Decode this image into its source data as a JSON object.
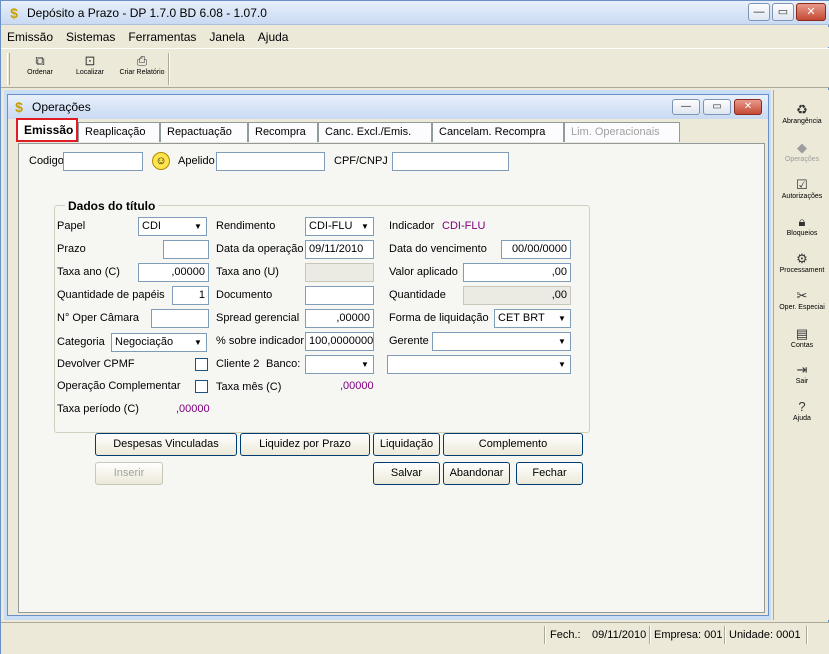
{
  "window": {
    "title": "Depósito a Prazo - DP 1.7.0 BD 6.08 - 1.07.0"
  },
  "menu": [
    "Emissão",
    "Sistemas",
    "Ferramentas",
    "Janela",
    "Ajuda"
  ],
  "toolbar": {
    "ordenar": "Ordenar",
    "localizar": "Localizar",
    "relatorio": "Criar Relatório"
  },
  "sidebar": {
    "abrangencia": "Abrangência",
    "operacoes": "Operações",
    "autorizacoes": "Autorizações",
    "bloqueios": "Bloqueios",
    "processamento": "Processament",
    "oper_especiais": "Oper. Especiai",
    "contas": "Contas",
    "sair": "Sair",
    "ajuda": "Ajuda"
  },
  "child": {
    "title": "Operações"
  },
  "tabs": [
    "Emissão",
    "Reaplicação",
    "Repactuação",
    "Recompra",
    "Canc. Excl./Emis.",
    "Cancelam. Recompra",
    "Lim. Operacionais"
  ],
  "top": {
    "codigo_label": "Codigo",
    "apelido_label": "Apelido",
    "cpf_label": "CPF/CNPJ",
    "codigo": "",
    "apelido": "",
    "cpf": ""
  },
  "group": {
    "title": "Dados do título"
  },
  "fields": {
    "papel_label": "Papel",
    "papel": "CDI",
    "rendimento_label": "Rendimento",
    "rendimento": "CDI-FLU",
    "indicador_label": "Indicador",
    "indicador": "CDI-FLU",
    "prazo_label": "Prazo",
    "prazo": "",
    "data_op_label": "Data da operação",
    "data_op": "09/11/2010",
    "data_venc_label": "Data do vencimento",
    "data_venc": "00/00/0000",
    "taxa_c_label": "Taxa ano (C)",
    "taxa_c": ",00000",
    "taxa_u_label": "Taxa ano (U)",
    "taxa_u": "",
    "valor_aplicado_label": "Valor aplicado",
    "valor_aplicado": ",00",
    "qtd_papeis_label": "Quantidade de papéis",
    "qtd_papeis": "1",
    "documento_label": "Documento",
    "documento": "",
    "quantidade_label": "Quantidade",
    "quantidade": ",00",
    "oper_camara_label": "N° Oper Câmara",
    "oper_camara": "",
    "spread_label": "Spread gerencial",
    "spread": ",00000",
    "forma_liq_label": "Forma de liquidação",
    "forma_liq": "CET BRT",
    "categoria_label": "Categoria",
    "categoria": "Negociação",
    "pct_indicador_label": "% sobre indicador",
    "pct_indicador": "100,0000000",
    "gerente_label": "Gerente",
    "gerente": "",
    "devolver_cpmf_label": "Devolver CPMF",
    "cliente2_label": "Cliente 2",
    "banco_label": "Banco:",
    "banco": "",
    "banco2": "",
    "op_compl_label": "Operação Complementar",
    "taxa_mes_label": "Taxa mês (C)",
    "taxa_mes": ",00000",
    "taxa_periodo_label": "Taxa período (C)",
    "taxa_periodo": ",00000"
  },
  "buttons": {
    "despesas": "Despesas Vinculadas",
    "liquidez": "Liquidez por Prazo",
    "liquidacao": "Liquidação",
    "complemento": "Complemento",
    "inserir": "Inserir",
    "salvar": "Salvar",
    "abandonar": "Abandonar",
    "fechar": "Fechar"
  },
  "status": {
    "fech": "Fech.:",
    "fech_date": "09/11/2010",
    "empresa": "Empresa: 001",
    "unidade": "Unidade: 0001"
  }
}
